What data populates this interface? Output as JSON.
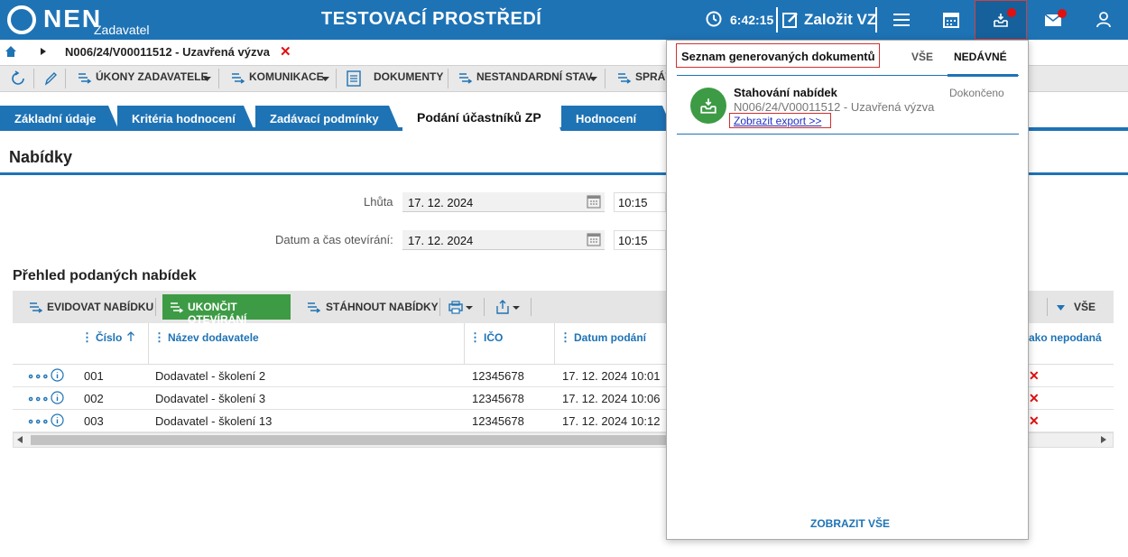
{
  "header": {
    "logo": "NEN",
    "logo_sub": "Zadavatel",
    "env_title": "TESTOVACÍ PROSTŘEDÍ",
    "clock_time": "6:42:15",
    "create_label": "Založit VZ"
  },
  "breadcrumb": {
    "text": "N006/24/V00011512 - Uzavřená výzva",
    "close": "✕"
  },
  "toolbar": {
    "ukony": "ÚKONY ZADAVATELE",
    "komunikace": "KOMUNIKACE",
    "dokumenty": "DOKUMENTY",
    "nestandardni": "NESTANDARDNÍ STAV",
    "sprava": "SPRÁV"
  },
  "tabs": [
    {
      "label": "Základní údaje"
    },
    {
      "label": "Kritéria hodnocení"
    },
    {
      "label": "Zadávací podmínky"
    },
    {
      "label": "Podání účastníků ZP"
    },
    {
      "label": "Hodnocení"
    }
  ],
  "section": {
    "title": "Nabídky",
    "deadline_label": "Lhůta",
    "deadline_date": "17. 12. 2024",
    "deadline_time": "10:15",
    "opening_label": "Datum a čas otevírání:",
    "opening_date": "17. 12. 2024",
    "opening_time": "10:15"
  },
  "overview": {
    "title": "Přehled podaných nabídek",
    "btn_evidovat": "EVIDOVAT NABÍDKU",
    "btn_ukoncit": "UKONČIT OTEVÍRÁNÍ",
    "btn_stahnout": "STÁHNOUT NABÍDKY",
    "btn_vse": "VŠE",
    "columns": {
      "cislo": "Číslo",
      "nazev": "Název dodavatele",
      "ico": "IČO",
      "datum": "Datum podání",
      "nepodana": "ako nepodaná"
    },
    "rows": [
      {
        "cislo": "001",
        "nazev": "Dodavatel - školení 2",
        "ico": "12345678",
        "datum": "17. 12. 2024 10:01",
        "flag": "✕"
      },
      {
        "cislo": "002",
        "nazev": "Dodavatel - školení 3",
        "ico": "12345678",
        "datum": "17. 12. 2024 10:06",
        "flag": "✕"
      },
      {
        "cislo": "003",
        "nazev": "Dodavatel - školení 13",
        "ico": "12345678",
        "datum": "17. 12. 2024 10:12",
        "flag": "✕"
      }
    ]
  },
  "panel": {
    "title": "Seznam generovaných dokumentů",
    "tab_all": "VŠE",
    "tab_recent": "NEDÁVNÉ",
    "item": {
      "title": "Stahování nabídek",
      "subtitle": "N006/24/V00011512 - Uzavřená výzva",
      "status": "Dokončeno",
      "link": "Zobrazit export >>"
    },
    "show_all": "ZOBRAZIT VŠE"
  },
  "colors": {
    "brand_blue": "#1e73b5",
    "green": "#3d9b45",
    "alert_red": "#e01010"
  }
}
